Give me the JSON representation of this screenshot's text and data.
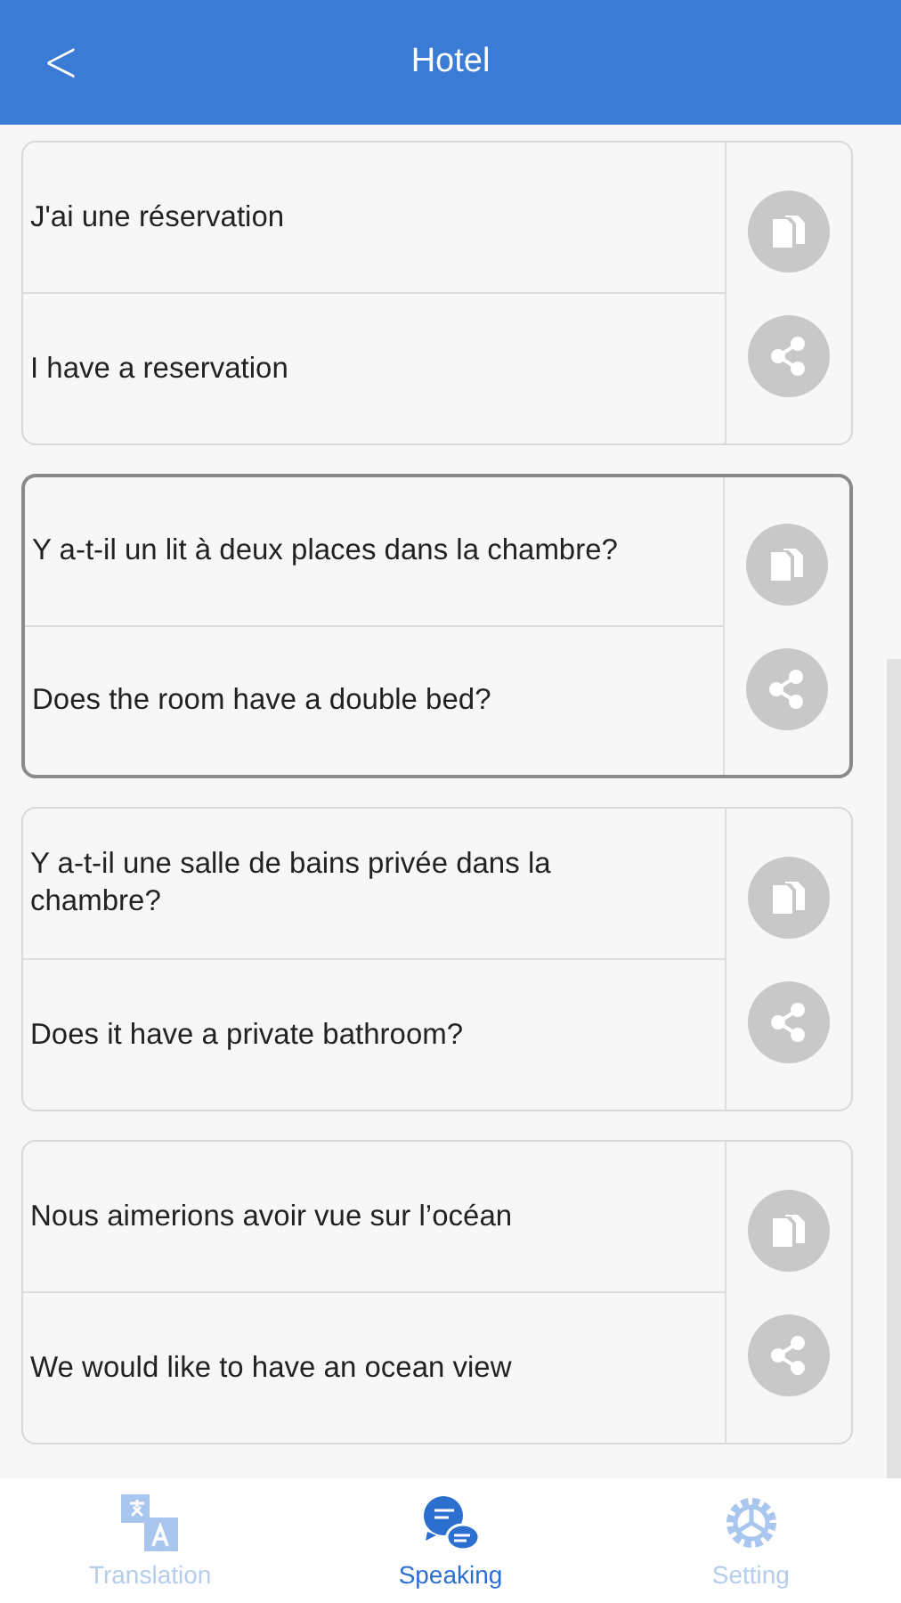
{
  "header": {
    "back": "<",
    "title": "Hotel"
  },
  "phrases": [
    {
      "source": "J'ai une réservation",
      "target": "I have a reservation",
      "selected": false
    },
    {
      "source": "Y a-t-il un lit à deux places dans la chambre?",
      "target": "Does the room have a double bed?",
      "selected": true
    },
    {
      "source": "Y a-t-il une salle de bains privée dans la chambre?",
      "target": "Does it have a private bathroom?",
      "selected": false
    },
    {
      "source": "Nous aimerions avoir vue sur l’océan",
      "target": "We would like to have an ocean view",
      "selected": false
    }
  ],
  "tabs": [
    {
      "label": "Translation",
      "kind": "translate",
      "selected": false
    },
    {
      "label": "Speaking",
      "kind": "speak",
      "selected": true
    },
    {
      "label": "Setting",
      "kind": "settings",
      "selected": false
    }
  ]
}
